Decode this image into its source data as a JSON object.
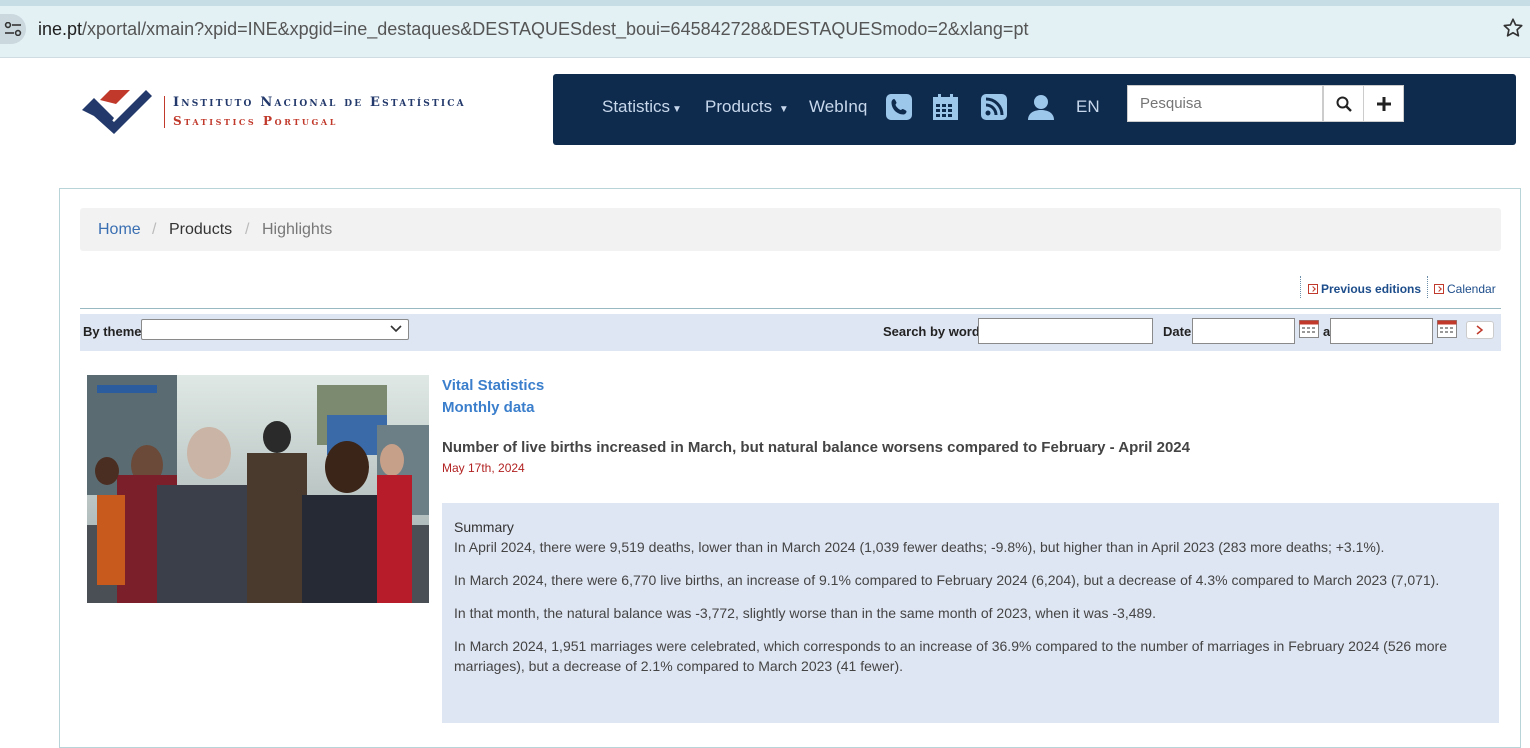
{
  "browser": {
    "url_host": "ine.pt",
    "url_path": "/xportal/xmain?xpid=INE&xpgid=ine_destaques&DESTAQUESdest_boui=645842728&DESTAQUESmodo=2&xlang=pt"
  },
  "logo": {
    "line1": "Instituto Nacional de Estatística",
    "line2": "Statistics Portugal",
    "colors": {
      "blue": "#23396b",
      "red": "#c0392b"
    }
  },
  "nav": {
    "items": [
      "Statistics",
      "Products",
      "WebInq"
    ],
    "icons": [
      "phone-icon",
      "calendar-icon",
      "rss-icon",
      "user-icon"
    ],
    "language": "EN",
    "search_placeholder": "Pesquisa",
    "background": "#0e2a4d"
  },
  "breadcrumb": {
    "home": "Home",
    "products": "Products",
    "current": "Highlights",
    "separator": "/"
  },
  "toplinks": {
    "previous_editions": "Previous editions",
    "calendar": "Calendar"
  },
  "filters": {
    "by_theme": "By theme",
    "search_by_word": "Search by word",
    "date": "Date",
    "to": "a"
  },
  "article": {
    "theme": "Vital Statistics",
    "subtheme": "Monthly data",
    "headline": "Number of live births increased in March, but natural balance worsens compared to February - April 2024",
    "date": "May 17th, 2024",
    "summary_title": "Summary",
    "paragraphs": [
      "In April 2024, there were 9,519 deaths, lower than in March 2024 (1,039 fewer deaths; -9.8%), but higher than in April 2023 (283 more deaths; +3.1%).",
      "In March 2024, there were 6,770 live births, an increase of 9.1% compared to February 2024 (6,204), but a decrease of 4.3% compared to March 2023 (7,071).",
      "In that month, the natural balance was -3,772, slightly worse than in the same month of 2023, when it was -3,489.",
      "In March 2024, 1,951 marriages were celebrated, which corresponds to an increase of 36.9% compared to the number of marriages in February 2024 (526 more marriages), but a decrease of 2.1% compared to March 2023 (41 fewer)."
    ]
  }
}
